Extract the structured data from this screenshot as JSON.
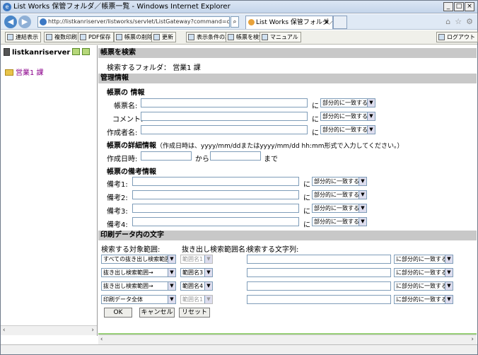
{
  "window": {
    "title": "List Works 保管フォルダ／帳票一覧 - Windows Internet Explorer",
    "url": "http://listkanriserver/listworks/servlet/ListGateway?command=open",
    "tab": "List Works 保管フォルダ／帳..."
  },
  "toolbar": {
    "items": [
      "連結表示",
      "複数印刷",
      "PDF保存",
      "帳票の削除",
      "更新",
      "表示条件の設定",
      "帳票を検索",
      "マニュアル"
    ],
    "logout": "ログアウト"
  },
  "sidebar": {
    "server": "listkanriserver",
    "folder": "営業1 課"
  },
  "search": {
    "header": "帳票を検索",
    "folder_label": "検索するフォルダ：",
    "folder_value": "営業1 課"
  },
  "mgmt": {
    "header": "管理情報",
    "report_info": "帳票の 情報",
    "report_name": "帳票名:",
    "comment": "コメント:",
    "creator": "作成者名:",
    "ni": "に",
    "match": "部分的に一致する",
    "detail": "帳票の詳細情報",
    "detail_note": "（作成日時は、yyyy/mm/ddまたはyyyy/mm/dd hh:mm形式で入力してください。）",
    "created": "作成日時:",
    "from": "から",
    "until": "まで",
    "remarks_header": "帳票の備考情報",
    "remarks": [
      "備考1:",
      "備考2:",
      "備考3:",
      "備考4:"
    ]
  },
  "print": {
    "header": "印刷データ内の文字",
    "col1": "検索する対象範囲:",
    "col2": "抜き出し検索範囲名:",
    "col3": "検索する文字列:",
    "rows": [
      {
        "scope": "すべての抜き出し検索範囲",
        "range": "範囲名1",
        "enabled": false,
        "match": "に部分的に一致する"
      },
      {
        "scope": "抜き出し検索範囲→",
        "range": "範囲名3",
        "enabled": true,
        "match": "に部分的に一致する"
      },
      {
        "scope": "抜き出し検索範囲→",
        "range": "範囲名4",
        "enabled": true,
        "match": "に部分的に一致する"
      },
      {
        "scope": "印刷データ全体",
        "range": "範囲名1",
        "enabled": false,
        "match": "に部分的に一致する"
      }
    ]
  },
  "buttons": {
    "ok": "OK",
    "cancel": "キャンセル",
    "reset": "リセット"
  }
}
